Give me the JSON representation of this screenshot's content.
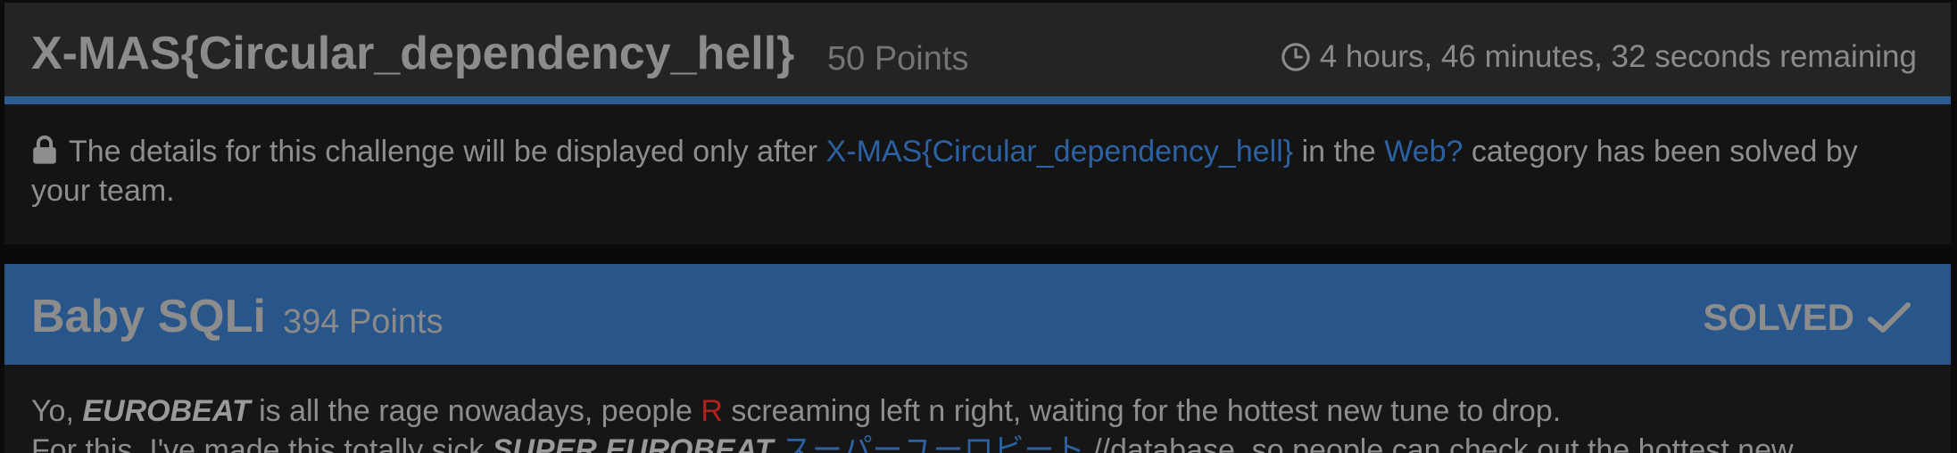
{
  "challenges": [
    {
      "title": "X-MAS{Circular_dependency_hell}",
      "points": "50 Points",
      "timer_text": "4 hours, 46 minutes, 32 seconds remaining",
      "locked_message": {
        "prefix": "The details for this challenge will be displayed only after",
        "dependency_link": "X-MAS{Circular_dependency_hell}",
        "middle": "in the",
        "category_link": "Web?",
        "suffix": "category has been solved by your team."
      }
    },
    {
      "title": "Baby SQLi",
      "points": "394 Points",
      "status": "SOLVED",
      "description": {
        "line1_a": "Yo,",
        "line1_em": "EUROBEAT",
        "line1_b": "is all the rage nowadays, people",
        "line1_red": "R",
        "line1_c": "screaming left n right, waiting for the hottest new tune to drop.",
        "line2_a": "For this, I've made this totally sick",
        "line2_em": "SUPER EUROBEAT",
        "line2_link": "スーパーユーロビート",
        "line2_c": "//database, so people can check out the hottest new"
      }
    }
  ],
  "colors": {
    "header_bar": "#242424",
    "accent_blue": "#2e5c90",
    "solved_header": "#28558a",
    "link_blue": "#2c62a3",
    "highlight_red": "#b0221f"
  },
  "icons": [
    "clock-icon",
    "lock-icon",
    "check-icon"
  ]
}
